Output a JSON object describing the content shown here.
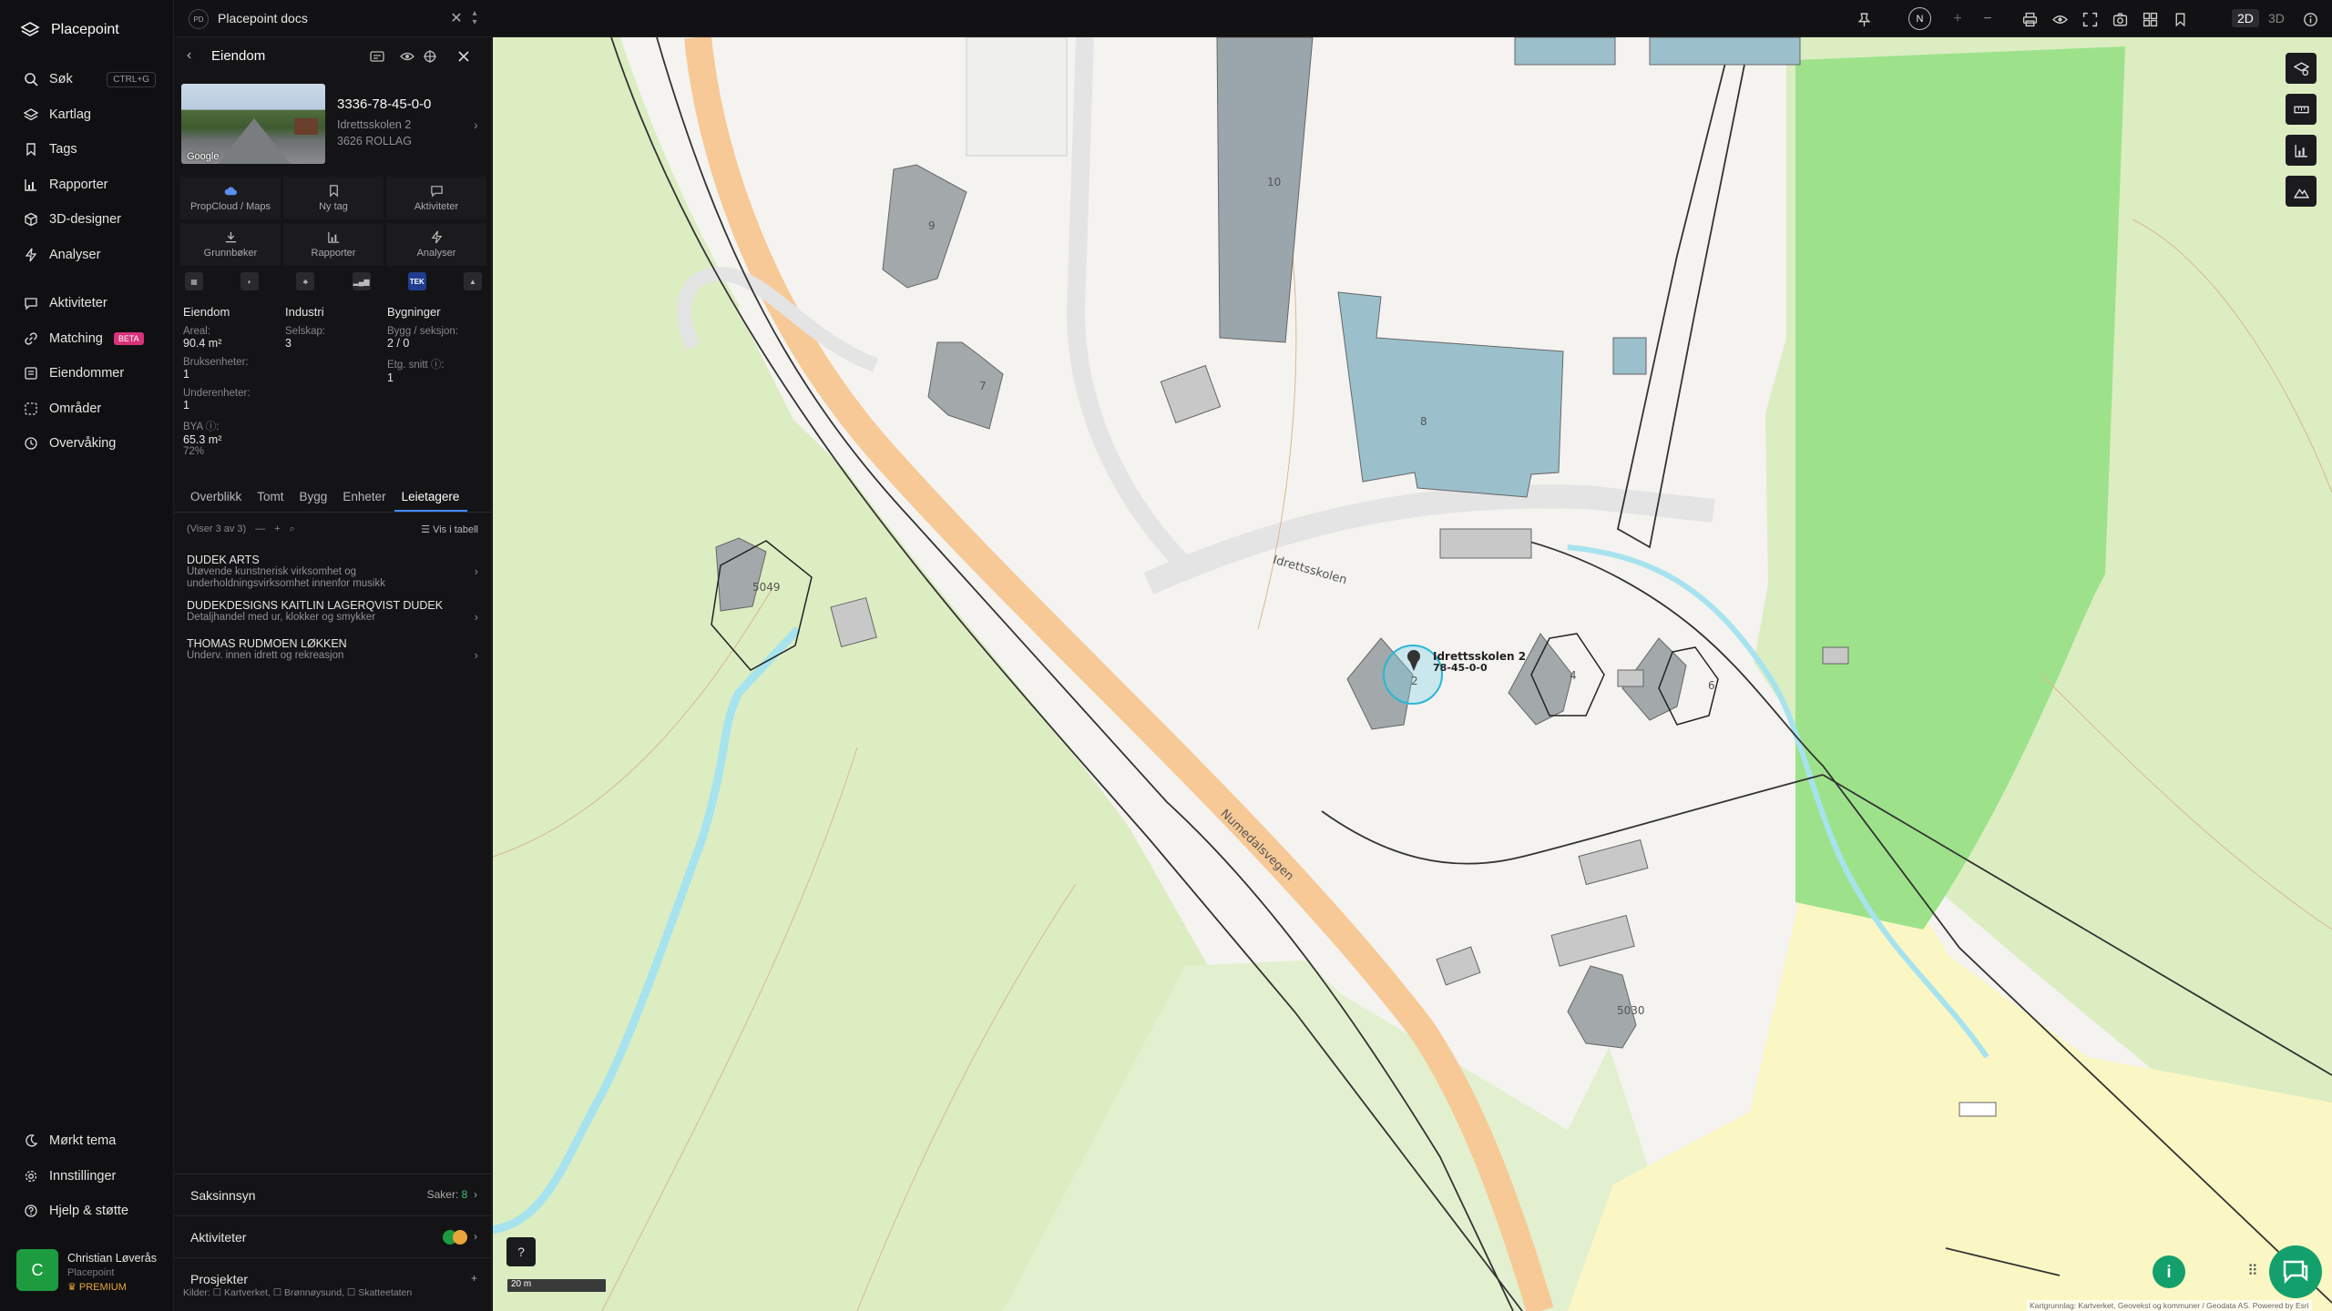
{
  "app": {
    "name": "Placepoint"
  },
  "nav": {
    "top": [
      {
        "id": "sok",
        "label": "Søk",
        "icon": "search-icon",
        "kbd": "CTRL+G"
      },
      {
        "id": "kartlag",
        "label": "Kartlag",
        "icon": "layers-icon"
      },
      {
        "id": "tags",
        "label": "Tags",
        "icon": "bookmark-icon"
      },
      {
        "id": "rapporter",
        "label": "Rapporter",
        "icon": "bar-chart-icon"
      },
      {
        "id": "3d",
        "label": "3D-designer",
        "icon": "cube-icon"
      },
      {
        "id": "analyser",
        "label": "Analyser",
        "icon": "lightning-icon"
      }
    ],
    "mid": [
      {
        "id": "aktiviteter",
        "label": "Aktiviteter",
        "icon": "chat-icon"
      },
      {
        "id": "matching",
        "label": "Matching",
        "icon": "link-icon",
        "badge": "BETA"
      },
      {
        "id": "eiendommer",
        "label": "Eiendommer",
        "icon": "list-icon"
      },
      {
        "id": "omrader",
        "label": "Områder",
        "icon": "area-icon"
      },
      {
        "id": "overvaking",
        "label": "Overvåking",
        "icon": "clock-icon"
      }
    ],
    "bottom": [
      {
        "id": "tema",
        "label": "Mørkt tema",
        "icon": "moon-icon"
      },
      {
        "id": "innst",
        "label": "Innstillinger",
        "icon": "gear-icon"
      },
      {
        "id": "hjelp",
        "label": "Hjelp & støtte",
        "icon": "help-icon"
      }
    ]
  },
  "user": {
    "initial": "C",
    "name": "Christian Løverås",
    "org": "Placepoint",
    "plan": "PREMIUM"
  },
  "topbar": {
    "doc_badge": "PD",
    "doc_title": "Placepoint docs",
    "north": "N",
    "mode_2d": "2D",
    "mode_3d": "3D"
  },
  "panel": {
    "title": "Eiendom",
    "google": "Google",
    "property_id": "3336-78-45-0-0",
    "address1": "Idrettsskolen 2",
    "address2": "3626 ROLLAG",
    "actions_row1": [
      {
        "label": "PropCloud / Maps",
        "icon": "cloud-icon"
      },
      {
        "label": "Ny tag",
        "icon": "bookmark-icon"
      },
      {
        "label": "Aktiviteter",
        "icon": "chat-icon"
      }
    ],
    "actions_row2": [
      {
        "label": "Grunnbøker",
        "icon": "download-icon"
      },
      {
        "label": "Rapporter",
        "icon": "bar-chart-icon"
      },
      {
        "label": "Analyser",
        "icon": "lightning-icon"
      }
    ],
    "mini_tek": "TEK",
    "eiendom": {
      "heading": "Eiendom",
      "areal_label": "Areal:",
      "areal_value": "90.4 m²",
      "bruks_label": "Bruksenheter:",
      "bruks_value": "1",
      "under_label": "Underenheter:",
      "under_value": "1",
      "bya_label": "BYA ⓘ:",
      "bya_value": "65.3 m²",
      "bya_pct": "72%"
    },
    "industri": {
      "heading": "Industri",
      "selskap_label": "Selskap:",
      "selskap_value": "3"
    },
    "bygninger": {
      "heading": "Bygninger",
      "bygg_label": "Bygg / seksjon:",
      "bygg_value": "2 / 0",
      "etg_label": "Etg. snitt ⓘ:",
      "etg_value": "1"
    },
    "tabs": [
      "Overblikk",
      "Tomt",
      "Bygg",
      "Enheter",
      "Leietagere"
    ],
    "list_count": "(Viser 3 av 3)",
    "vis_tabell": "Vis i tabell",
    "tenants": [
      {
        "name": "DUDEK ARTS",
        "desc": "Utøvende kunstnerisk virksomhet og underholdningsvirksomhet innenfor musikk"
      },
      {
        "name": "DUDEKDESIGNS KAITLIN LAGERQVIST DUDEK",
        "desc": "Detaljhandel med ur, klokker og smykker"
      },
      {
        "name": "THOMAS RUDMOEN LØKKEN",
        "desc": "Underv. innen idrett og rekreasjon"
      }
    ],
    "saksinnsyn_label": "Saksinnsyn",
    "saker_label": "Saker:",
    "saker_value": "8",
    "aktiviteter_label": "Aktiviteter",
    "prosjekter_label": "Prosjekter",
    "sources": "Kilder: ☐ Kartverket, ☐ Brønnøysund, ☐ Skatteetaten"
  },
  "map": {
    "labels": {
      "b10": "10",
      "b9": "9",
      "b7": "7",
      "b8": "8",
      "b5049": "5049",
      "b4": "4",
      "b6": "6",
      "b2": "2",
      "b5030": "5030",
      "road1": "Idrettsskolen",
      "road2": "Numedalsvegen",
      "sel1": "Idrettsskolen 2",
      "sel2": "78-45-0-0"
    },
    "scale": "20 m",
    "attribution": "Kartgrunnlag: Kartverket, Geovekst og kommuner / Geodata AS. Powered by Esri"
  },
  "colors": {
    "accent": "#3f8bff",
    "brand_green": "#14a06c",
    "beta": "#d8337a",
    "premium": "#e9a53a"
  }
}
